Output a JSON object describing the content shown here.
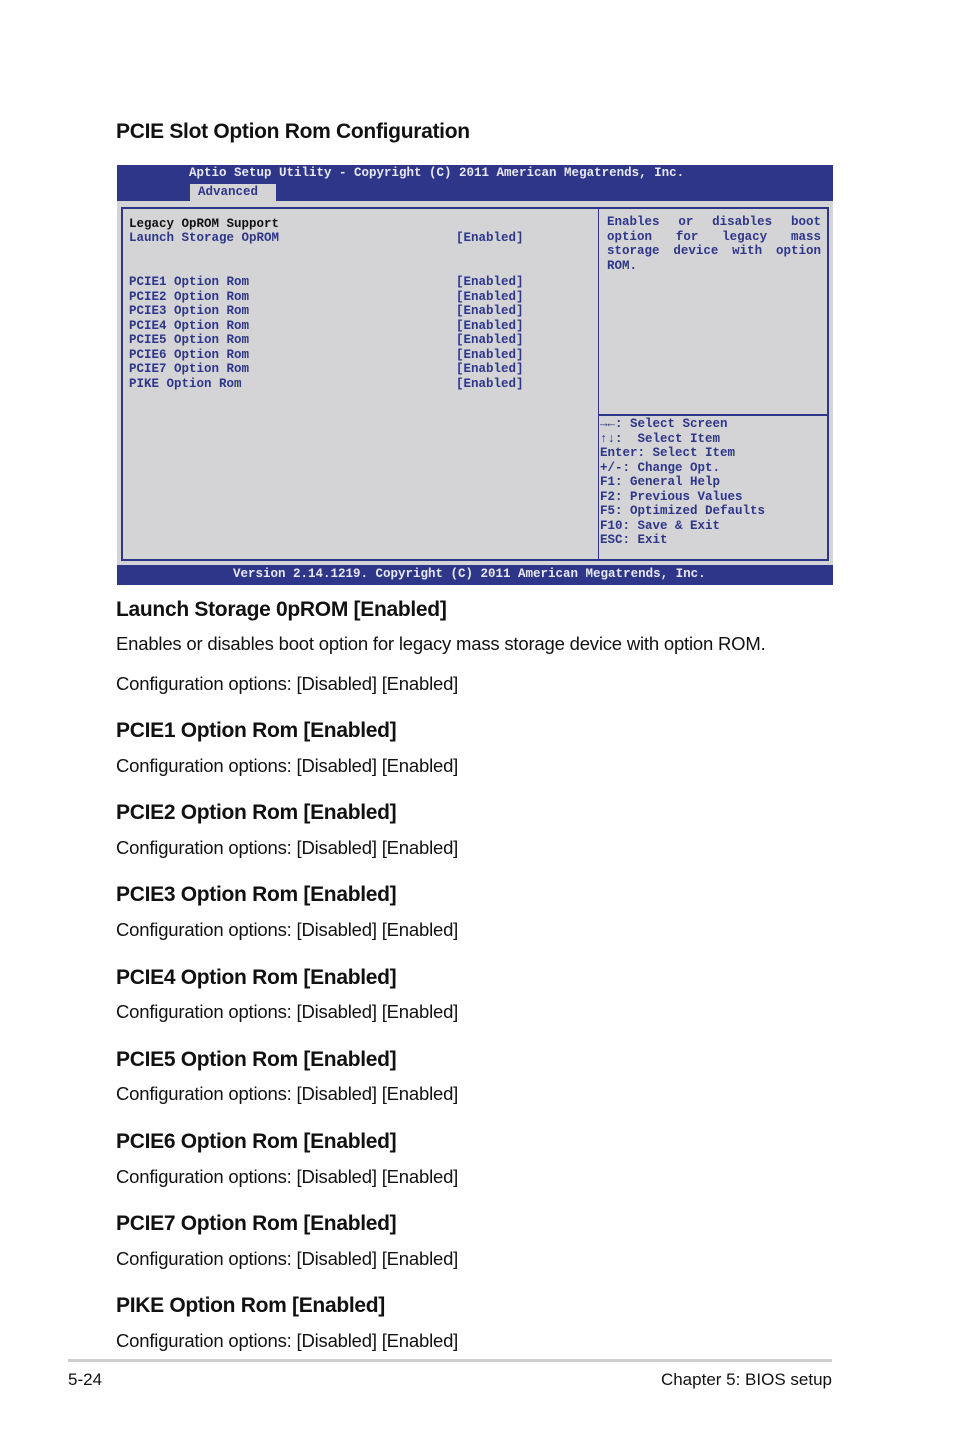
{
  "section_title": "PCIE Slot Option Rom Configuration",
  "bios": {
    "title": "Aptio Setup Utility - Copyright (C) 2011 American Megatrends, Inc.",
    "active_tab": "Advanced",
    "heading": "Legacy OpROM Support",
    "items": [
      {
        "label": "Launch Storage OpROM",
        "value": "[Enabled]"
      },
      {
        "label": "PCIE1 Option Rom",
        "value": "[Enabled]"
      },
      {
        "label": "PCIE2 Option Rom",
        "value": "[Enabled]"
      },
      {
        "label": "PCIE3 Option Rom",
        "value": "[Enabled]"
      },
      {
        "label": "PCIE4 Option Rom",
        "value": "[Enabled]"
      },
      {
        "label": "PCIE5 Option Rom",
        "value": "[Enabled]"
      },
      {
        "label": "PCIE6 Option Rom",
        "value": "[Enabled]"
      },
      {
        "label": "PCIE7 Option Rom",
        "value": "[Enabled]"
      },
      {
        "label": "PIKE Option Rom",
        "value": "[Enabled]"
      }
    ],
    "help_text": "Enables or disables boot option for legacy mass storage device with option ROM.",
    "key_help": [
      "→←: Select Screen",
      "↑↓:  Select Item",
      "Enter: Select Item",
      "+/-: Change Opt.",
      "F1: General Help",
      "F2: Previous Values",
      "F5: Optimized Defaults",
      "F10: Save & Exit",
      "ESC: Exit"
    ],
    "version": "Version 2.14.1219. Copyright (C) 2011 American Megatrends, Inc.",
    "colors": {
      "frame": "#2e3689",
      "panel": "#d4d4d6",
      "text": "#2e3689"
    }
  },
  "items": [
    {
      "title": "Launch Storage 0pROM [Enabled]",
      "description": "Enables or disables boot option for legacy mass storage device with option ROM.",
      "options": "Configuration options: [Disabled] [Enabled]"
    },
    {
      "title": "PCIE1 Option Rom [Enabled]",
      "options": "Configuration options: [Disabled] [Enabled]"
    },
    {
      "title": "PCIE2 Option Rom [Enabled]",
      "options": "Configuration options: [Disabled] [Enabled]"
    },
    {
      "title": "PCIE3 Option Rom [Enabled]",
      "options": "Configuration options: [Disabled] [Enabled]"
    },
    {
      "title": "PCIE4 Option Rom [Enabled]",
      "options": "Configuration options: [Disabled] [Enabled]"
    },
    {
      "title": "PCIE5 Option Rom [Enabled]",
      "options": "Configuration options: [Disabled] [Enabled]"
    },
    {
      "title": "PCIE6 Option Rom [Enabled]",
      "options": "Configuration options: [Disabled] [Enabled]"
    },
    {
      "title": "PCIE7 Option Rom [Enabled]",
      "options": "Configuration options: [Disabled] [Enabled]"
    },
    {
      "title": "PIKE Option Rom [Enabled]",
      "options": "Configuration options: [Disabled] [Enabled]"
    }
  ],
  "footer": {
    "page": "5-24",
    "chapter": "Chapter 5: BIOS setup"
  }
}
